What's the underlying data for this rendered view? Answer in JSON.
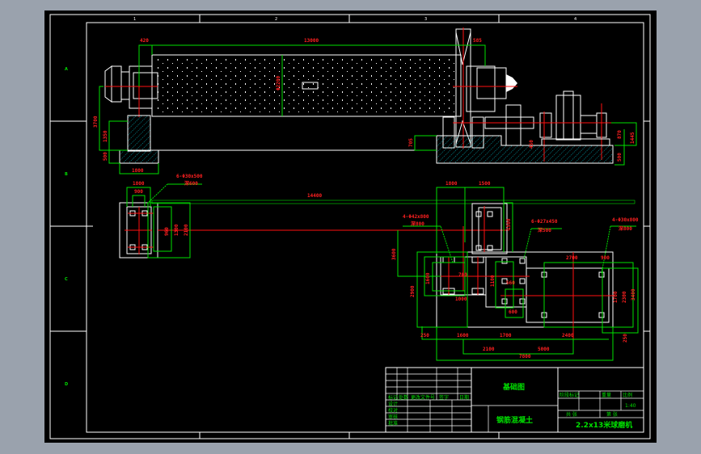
{
  "colors": {
    "background": "#000000",
    "frame": "#ffffff",
    "dimension": "#00e000",
    "centerline": "#ff1010",
    "hatch": "#00d8e8",
    "canvas_border": "#9aa2ad"
  },
  "zones": {
    "top": [
      "1",
      "2",
      "3",
      "4"
    ],
    "left": [
      "A",
      "B",
      "C",
      "D"
    ]
  },
  "elevation": {
    "dims": {
      "left_offset": "420",
      "shell_length": "13000",
      "shell_diameter": "Φ2200",
      "right_offset": "585",
      "height_total": "3700",
      "pier_height": "1350",
      "base_height": "500",
      "base_width": "1800",
      "right_height": "705",
      "motor_h1": "870",
      "motor_h2": "1445",
      "motor_h3": "500",
      "reducer_h": "450"
    }
  },
  "plan": {
    "dims": {
      "left_bolts": "6-Φ30x500",
      "left_depth": "深600",
      "left_w1": "1800",
      "left_w2": "900",
      "left_h1": "960",
      "left_h2": "1300",
      "left_h3": "2100",
      "span": "14400",
      "right_w1": "1800",
      "right_w2": "1500",
      "bolts_a": "4-Φ42x800",
      "depth_a": "深800",
      "bolts_b": "6-Φ27x450",
      "depth_b": "深500",
      "bolts_c": "4-Φ30x800",
      "depth_c": "深800",
      "h_left": "3600",
      "h_mid": "2900",
      "h_a": "1600",
      "h_b": "1500",
      "h_c": "1100",
      "w_a": "1000",
      "w_b": "700",
      "w_c": "600",
      "w_d": "560",
      "w_e": "2700",
      "w_f": "900",
      "bottom1": "250",
      "bottom2": "1600",
      "bottom3": "1700",
      "bottom4": "2400",
      "bottom5": "2100",
      "bottom6": "5000",
      "bottom7": "7800",
      "r1": "1700",
      "r2": "2300",
      "r3": "3400",
      "r4": "250"
    }
  },
  "title_block": {
    "drawing_name": "基础图",
    "material": "钢筋混凝土",
    "product": "2.2x13米球磨机",
    "row_labels": [
      "标记",
      "处数",
      "更改文件号",
      "签字",
      "日期"
    ],
    "left_labels": [
      "设计",
      "校对",
      "审核",
      "批准"
    ],
    "stage_headers": [
      "阶段标记",
      "重量",
      "比例"
    ],
    "scale": "1:40",
    "sheet_total": "共  张",
    "sheet_no": "第  张"
  }
}
